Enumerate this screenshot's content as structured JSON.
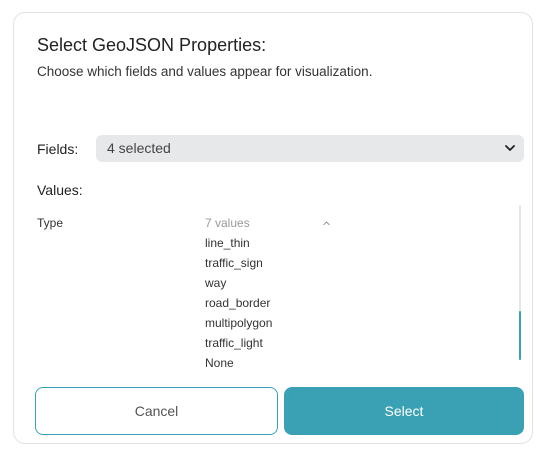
{
  "dialog": {
    "title": "Select GeoJSON Properties:",
    "subtitle": "Choose which fields and values appear for visualization."
  },
  "fields": {
    "label": "Fields:",
    "selected": "4 selected",
    "icon": "chevron-down-icon"
  },
  "values": {
    "label": "Values:",
    "rows": [
      {
        "key": "Type",
        "count_label": "7 values",
        "expanded": true,
        "items": [
          "line_thin",
          "traffic_sign",
          "way",
          "road_border",
          "multipolygon",
          "traffic_light",
          "None"
        ]
      }
    ]
  },
  "buttons": {
    "cancel": "Cancel",
    "select": "Select"
  },
  "colors": {
    "accent": "#3aa0b4",
    "select_bg": "#e7e8ea",
    "border": "#dfe2e6"
  }
}
